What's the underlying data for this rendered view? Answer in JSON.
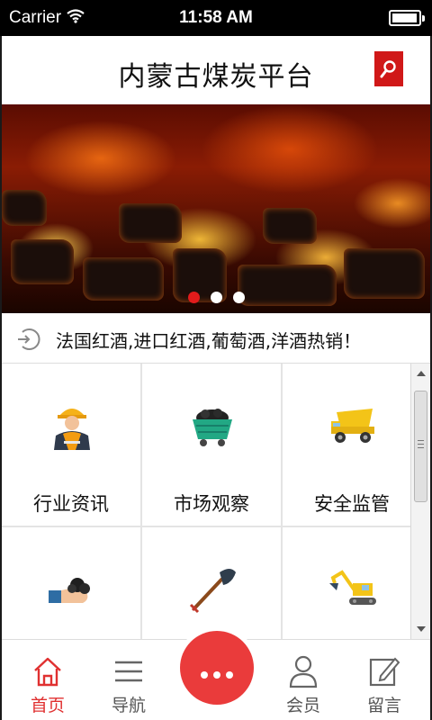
{
  "status_bar": {
    "carrier": "Carrier",
    "time": "11:58 AM",
    "battery_level": 0.95
  },
  "header": {
    "title": "内蒙古煤炭平台",
    "search_icon": "search-icon",
    "accent_color": "#d01818"
  },
  "banner": {
    "slide_count": 3,
    "active_slide": 1
  },
  "notice": {
    "icon": "refresh-arrow-icon",
    "text": "法国红酒,进口红酒,葡萄酒,洋酒热销！"
  },
  "grid": {
    "items": [
      {
        "label": "行业资讯",
        "icon": "worker-icon"
      },
      {
        "label": "市场观察",
        "icon": "coal-cart-icon"
      },
      {
        "label": "安全监管",
        "icon": "dump-truck-icon"
      },
      {
        "label": "",
        "icon": "hand-coal-icon"
      },
      {
        "label": "",
        "icon": "shovel-icon"
      },
      {
        "label": "",
        "icon": "excavator-icon"
      }
    ]
  },
  "tabbar": {
    "tabs": [
      {
        "label": "首页",
        "icon": "home-icon",
        "active": true
      },
      {
        "label": "导航",
        "icon": "menu-icon",
        "active": false
      },
      {
        "label": "会员",
        "icon": "user-icon",
        "active": false
      },
      {
        "label": "留言",
        "icon": "edit-icon",
        "active": false
      }
    ],
    "center_icon": "more-dots-icon",
    "active_color": "#e03030"
  }
}
